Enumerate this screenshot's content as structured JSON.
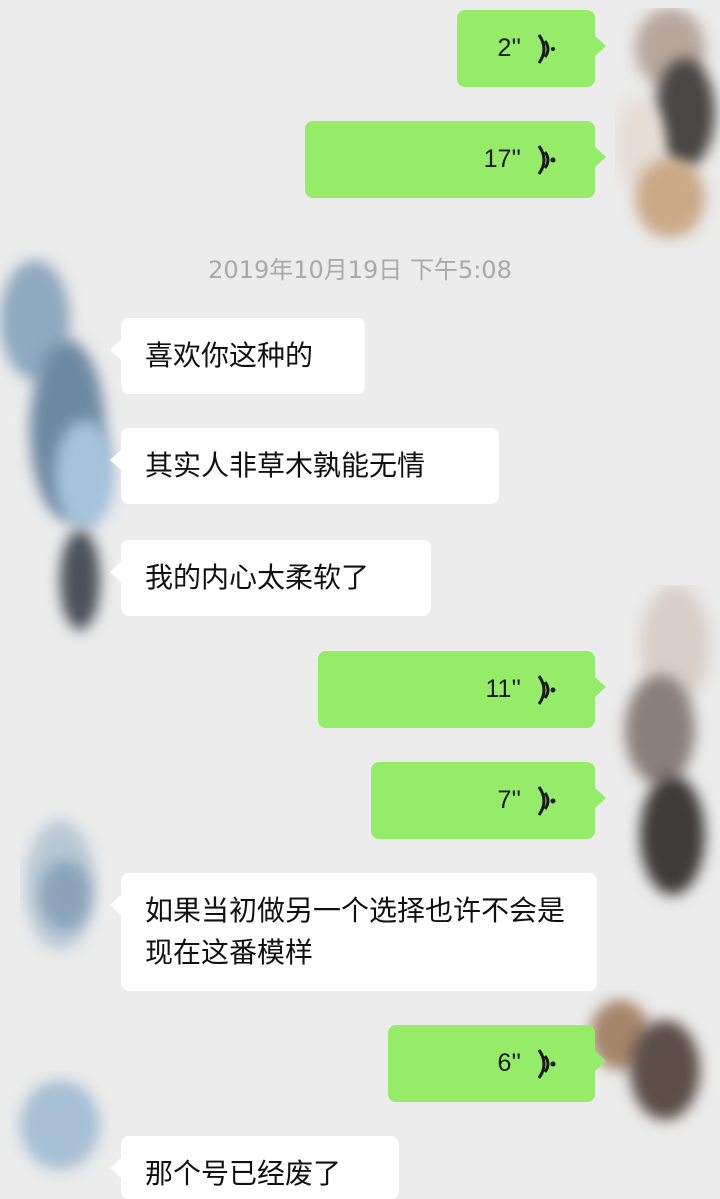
{
  "timestamp": "2019年10月19日 下午5:08",
  "outgoing_voice": [
    "2''",
    "17''",
    "11''",
    "7''",
    "6''"
  ],
  "incoming_text": [
    "喜欢你这种的",
    "其实人非草木孰能无情",
    "我的内心太柔软了",
    "如果当初做另一个选择也许不会是现在这番模样",
    "那个号已经废了"
  ],
  "colors": {
    "background": "#ececec",
    "outgoing_bubble": "#95ec69",
    "incoming_bubble": "#ffffff",
    "timestamp_text": "#a9a9a9"
  },
  "icons": [
    "voice-wave-icon",
    "avatar"
  ]
}
